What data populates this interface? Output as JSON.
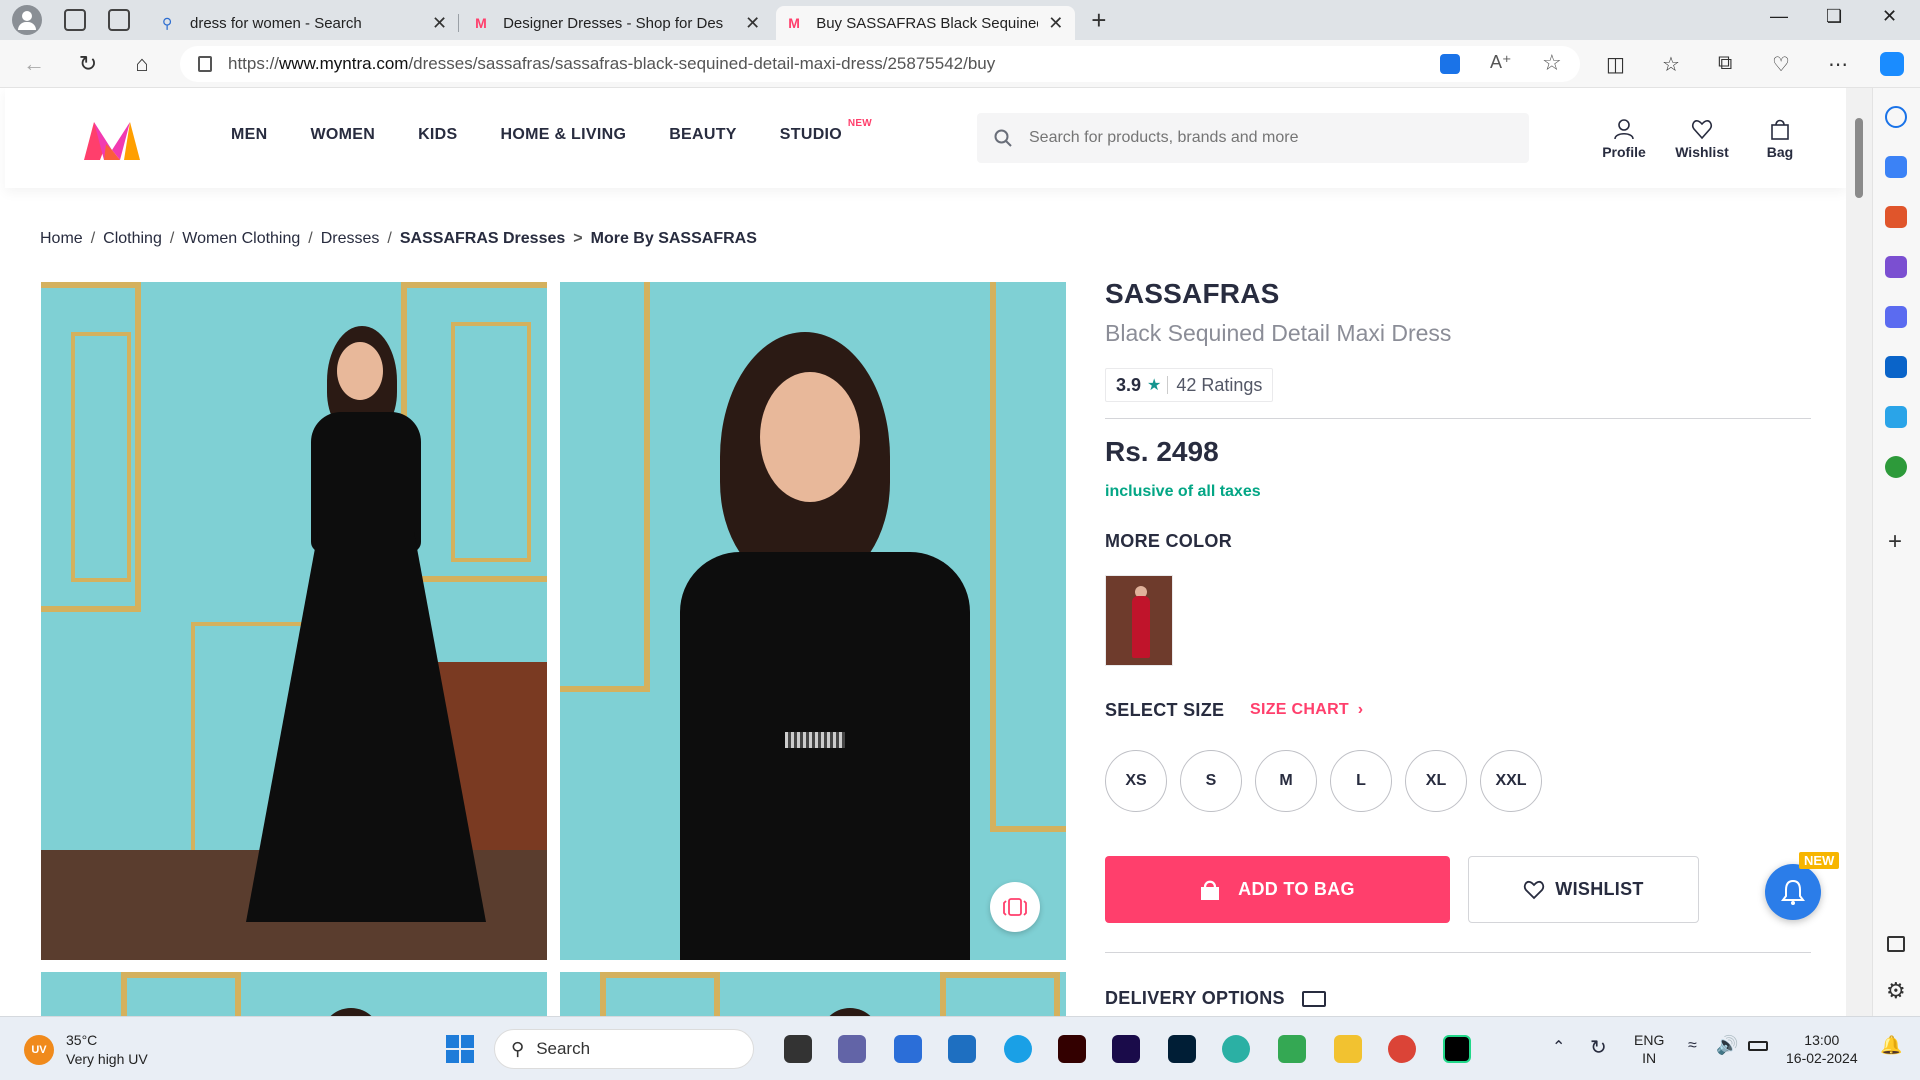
{
  "browser": {
    "tabs": [
      {
        "title": "dress for women - Search",
        "favicon": "search-icon"
      },
      {
        "title": "Designer Dresses - Shop for Des",
        "favicon": "myntra-icon"
      },
      {
        "title": "Buy SASSAFRAS Black Sequined D",
        "favicon": "myntra-icon",
        "active": true
      }
    ],
    "url_prefix": "https://",
    "url_host": "www.myntra.com",
    "url_path": "/dresses/sassafras/sassafras-black-sequined-detail-maxi-dress/25875542/buy"
  },
  "header": {
    "nav": [
      "MEN",
      "WOMEN",
      "KIDS",
      "HOME & LIVING",
      "BEAUTY",
      "STUDIO"
    ],
    "studio_badge": "NEW",
    "search_placeholder": "Search for products, brands and more",
    "actions": {
      "profile": "Profile",
      "wishlist": "Wishlist",
      "bag": "Bag"
    }
  },
  "breadcrumb": {
    "items": [
      "Home",
      "Clothing",
      "Women Clothing",
      "Dresses",
      "SASSAFRAS Dresses"
    ],
    "more": "More By SASSAFRAS"
  },
  "product": {
    "brand": "SASSAFRAS",
    "name": "Black Sequined Detail Maxi Dress",
    "rating": "3.9",
    "rating_count": "42 Ratings",
    "price": "Rs. 2498",
    "tax_note": "inclusive of all taxes",
    "more_color_title": "MORE COLOR",
    "select_size_title": "SELECT SIZE",
    "size_chart": "SIZE CHART",
    "sizes": [
      "XS",
      "S",
      "M",
      "L",
      "XL",
      "XXL"
    ],
    "add_to_bag": "ADD TO BAG",
    "wishlist": "WISHLIST",
    "delivery_title": "DELIVERY OPTIONS",
    "notification_badge": "NEW"
  },
  "colors": {
    "accent": "#ff3f6c",
    "success": "#03a685",
    "rating_star": "#14958f",
    "text": "#282c3f"
  },
  "taskbar": {
    "temperature": "35°C",
    "weather_desc": "Very high UV",
    "uv_badge": "UV",
    "search_label": "Search",
    "lang_top": "ENG",
    "lang_bottom": "IN",
    "time": "13:00",
    "date": "16-02-2024"
  }
}
